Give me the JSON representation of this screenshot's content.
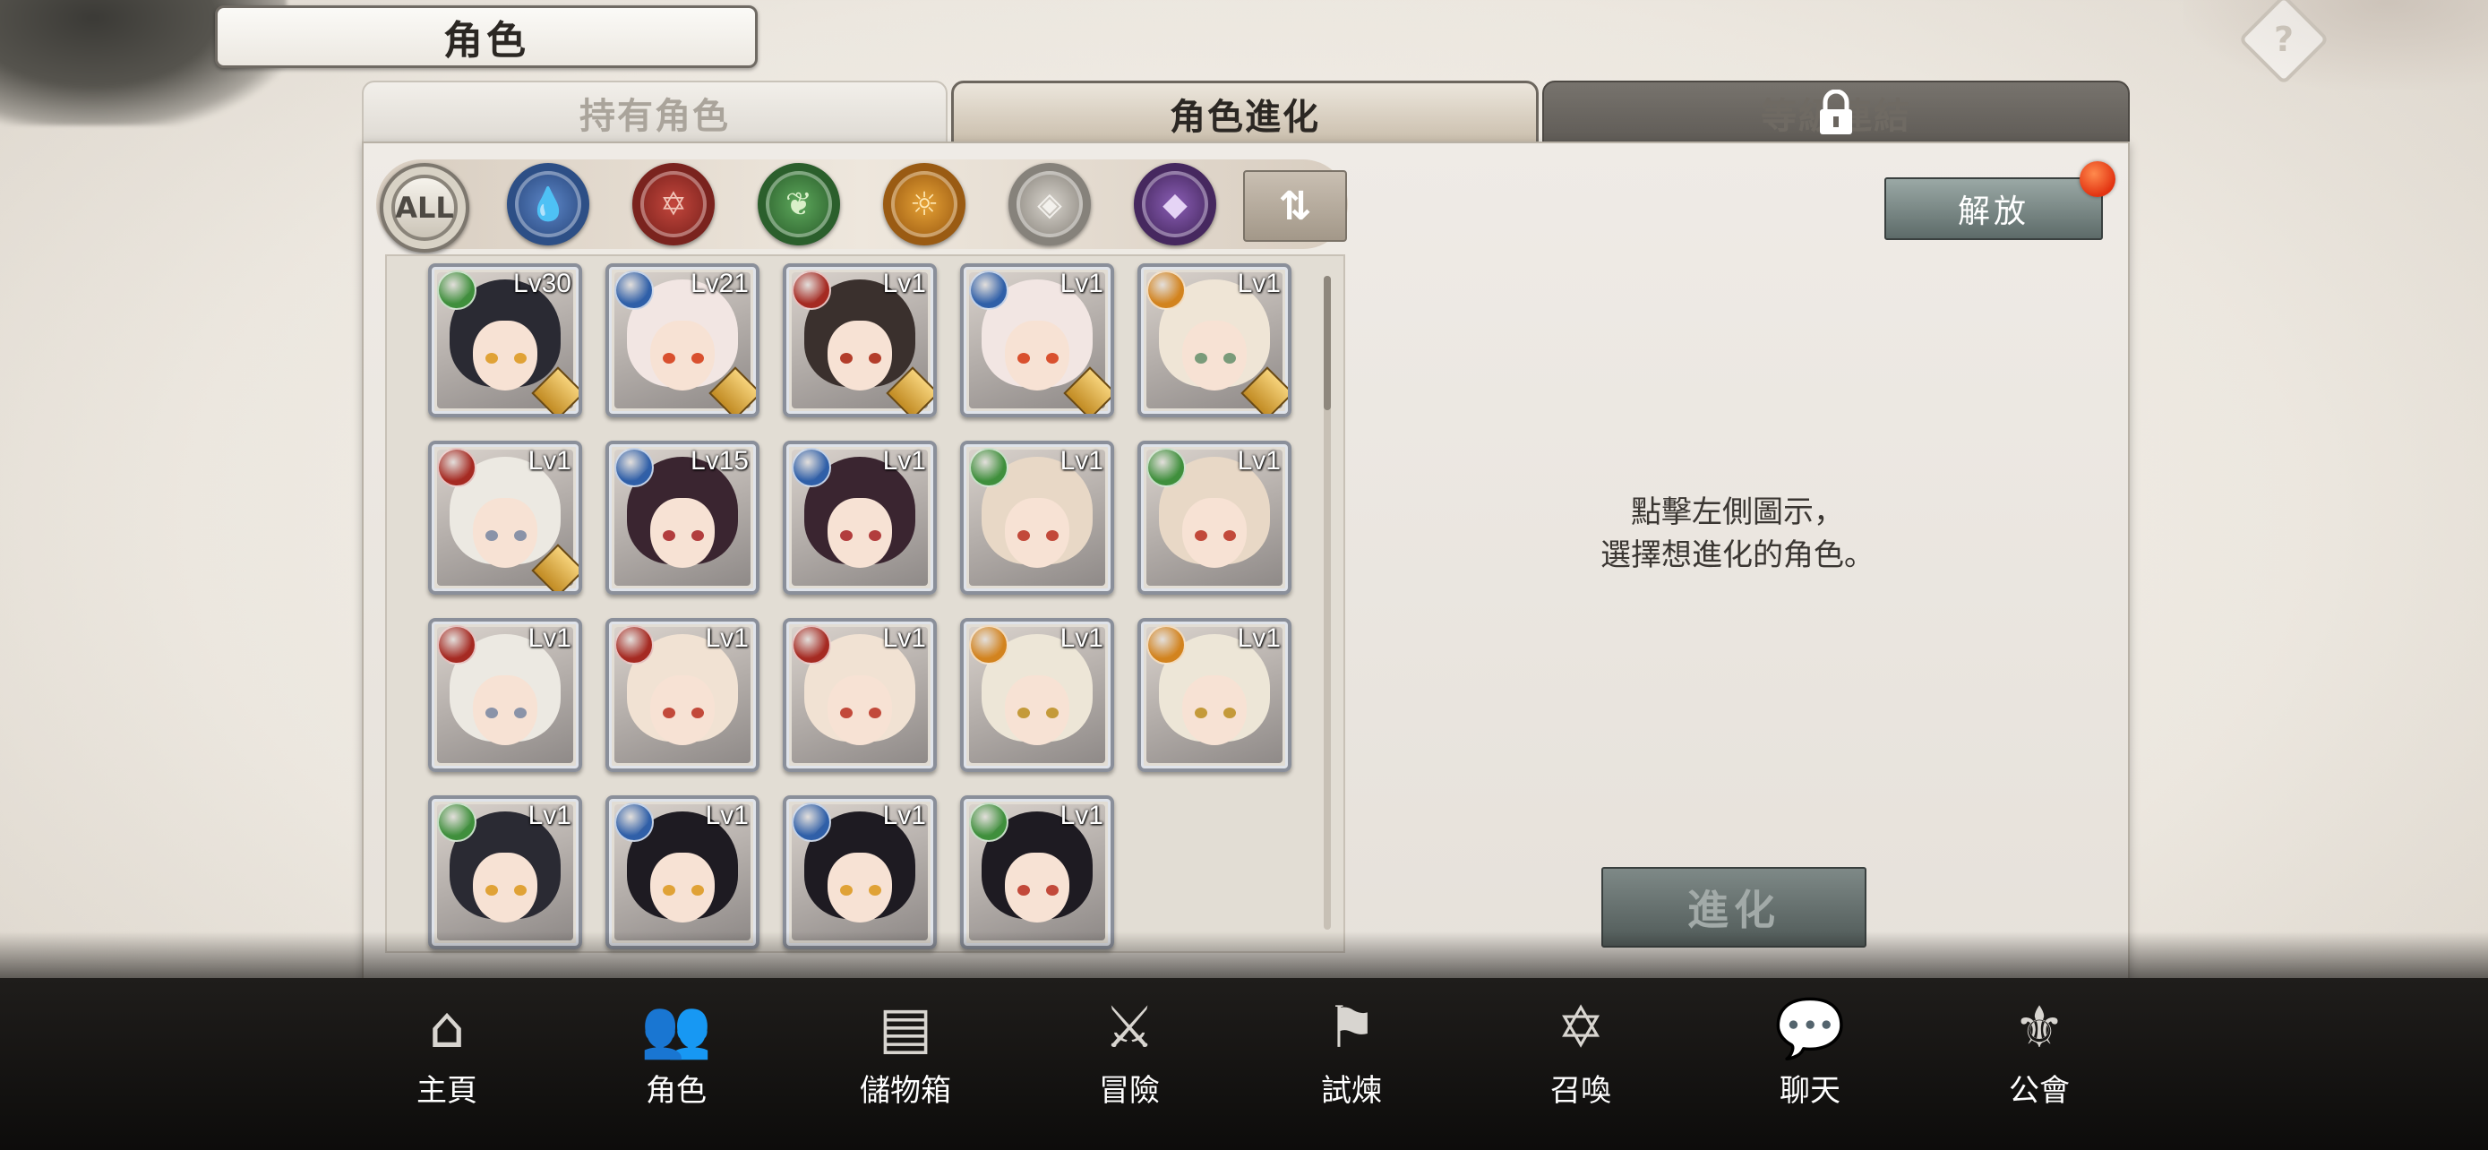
{
  "header": {
    "title": "角色"
  },
  "tabs": [
    {
      "label": "持有角色",
      "state": "inactive"
    },
    {
      "label": "角色進化",
      "state": "active"
    },
    {
      "label": "等級連結",
      "state": "locked"
    }
  ],
  "filters": [
    {
      "label": "ALL",
      "icon": "all-icon"
    },
    {
      "label": "",
      "icon": "water-element-icon"
    },
    {
      "label": "",
      "icon": "fire-element-icon"
    },
    {
      "label": "",
      "icon": "wind-element-icon"
    },
    {
      "label": "",
      "icon": "light-element-icon"
    },
    {
      "label": "",
      "icon": "neutral-element-icon"
    },
    {
      "label": "",
      "icon": "dark-element-icon"
    }
  ],
  "sort_label": "⇅",
  "release_button": "解放",
  "instruction": [
    "點擊左側圖示，",
    "選擇想進化的角色。"
  ],
  "evolve_button": "進化",
  "characters": [
    {
      "level": "Lv30",
      "element": "wind",
      "hair": "#2a2a33",
      "eyes": "#e0a236",
      "badge": true
    },
    {
      "level": "Lv21",
      "element": "water",
      "hair": "#f2e6e3",
      "eyes": "#d9502e",
      "badge": true
    },
    {
      "level": "Lv1",
      "element": "fire",
      "hair": "#3a302d",
      "eyes": "#b33d2a",
      "badge": true
    },
    {
      "level": "Lv1",
      "element": "water",
      "hair": "#f2e6e3",
      "eyes": "#d9502e",
      "badge": true
    },
    {
      "level": "Lv1",
      "element": "light",
      "hair": "#efe5d6",
      "eyes": "#7a9b7a",
      "badge": true
    },
    {
      "level": "Lv1",
      "element": "fire",
      "hair": "#ece9e2",
      "eyes": "#8a93a8",
      "badge": true
    },
    {
      "level": "Lv15",
      "element": "water",
      "hair": "#3a2530",
      "eyes": "#b23d3d",
      "badge": false
    },
    {
      "level": "Lv1",
      "element": "water",
      "hair": "#3a2530",
      "eyes": "#b23d3d",
      "badge": false
    },
    {
      "level": "Lv1",
      "element": "wind",
      "hair": "#e8d8c6",
      "eyes": "#c2493a",
      "badge": false
    },
    {
      "level": "Lv1",
      "element": "wind",
      "hair": "#e8d8c6",
      "eyes": "#c2493a",
      "badge": false
    },
    {
      "level": "Lv1",
      "element": "fire",
      "hair": "#ece9e2",
      "eyes": "#8a93a8",
      "badge": false
    },
    {
      "level": "Lv1",
      "element": "fire",
      "hair": "#f1e2d3",
      "eyes": "#c2493a",
      "badge": false
    },
    {
      "level": "Lv1",
      "element": "fire",
      "hair": "#f1e2d3",
      "eyes": "#c2493a",
      "badge": false
    },
    {
      "level": "Lv1",
      "element": "light",
      "hair": "#ede6d7",
      "eyes": "#c49a3a",
      "badge": false
    },
    {
      "level": "Lv1",
      "element": "light",
      "hair": "#ede6d7",
      "eyes": "#c49a3a",
      "badge": false
    },
    {
      "level": "Lv1",
      "element": "wind",
      "hair": "#2a2a33",
      "eyes": "#e0a236",
      "badge": false
    },
    {
      "level": "Lv1",
      "element": "water",
      "hair": "#1e1b22",
      "eyes": "#e0a236",
      "badge": false
    },
    {
      "level": "Lv1",
      "element": "water",
      "hair": "#1e1b22",
      "eyes": "#e0a236",
      "badge": false
    },
    {
      "level": "Lv1",
      "element": "wind",
      "hair": "#1e1b22",
      "eyes": "#c2493a",
      "badge": false
    }
  ],
  "element_colors": {
    "wind": "#3f8f3c",
    "water": "#2f5fa8",
    "fire": "#a52a22",
    "light": "#d2831e"
  },
  "bottom_nav": [
    {
      "label": "主頁",
      "icon": "home-icon"
    },
    {
      "label": "角色",
      "icon": "characters-icon"
    },
    {
      "label": "儲物箱",
      "icon": "storage-chest-icon"
    },
    {
      "label": "冒險",
      "icon": "crossed-swords-icon"
    },
    {
      "label": "試煉",
      "icon": "flag-icon"
    },
    {
      "label": "召喚",
      "icon": "summon-circle-icon"
    },
    {
      "label": "聊天",
      "icon": "chat-icon"
    },
    {
      "label": "公會",
      "icon": "guild-icon"
    }
  ]
}
